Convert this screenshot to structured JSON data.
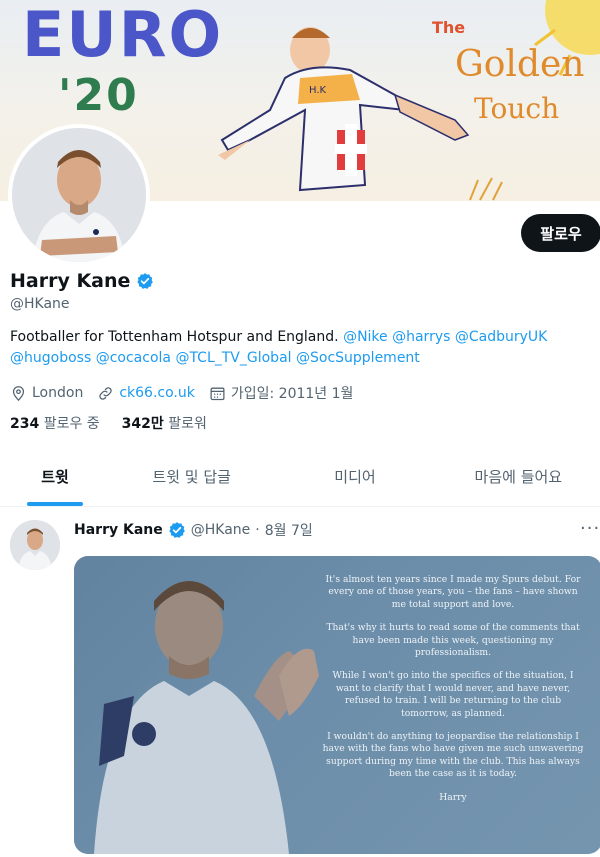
{
  "banner": {
    "title": "EURO",
    "year": "'20",
    "the": "The",
    "golden": "Golden",
    "touch": "Touch",
    "shirt_initials": "H.K"
  },
  "profile": {
    "follow_label": "팔로우",
    "name": "Harry Kane",
    "handle": "@HKane",
    "bio_text": "Footballer for Tottenham Hotspur and England.",
    "bio_mentions": [
      "@Nike",
      "@harrys",
      "@CadburyUK",
      "@hugoboss",
      "@cocacola",
      "@TCL_TV_Global",
      "@SocSupplement"
    ],
    "location": "London",
    "website": "ck66.co.uk",
    "joined": "가입일: 2011년 1월",
    "following_count": "234",
    "following_label": "팔로우 중",
    "followers_count": "342만",
    "followers_label": "팔로워"
  },
  "tabs": [
    {
      "label": "트윗",
      "active": true
    },
    {
      "label": "트윗 및 답글",
      "active": false
    },
    {
      "label": "미디어",
      "active": false
    },
    {
      "label": "마음에 들어요",
      "active": false
    }
  ],
  "tweet": {
    "name": "Harry Kane",
    "handle": "@HKane",
    "separator": "·",
    "date": "8월 7일",
    "more": "···",
    "statement": [
      "It's almost ten years since I made my Spurs debut. For every one of those years, you – the fans – have shown me total support and love.",
      "That's why it hurts to read some of the comments that have been made this week, questioning my professionalism.",
      "While I won't go into the specifics of the situation, I want to clarify that I would never, and have never, refused to train. I will be returning to the club tomorrow, as planned.",
      "I wouldn't do anything to jeopardise the relationship I have with the fans who have given me such unwavering support during my time with the club. This has always been the case as it is today.",
      "Harry"
    ]
  },
  "colors": {
    "accent": "#1d9bf0",
    "text": "#0f1419",
    "muted": "#536471",
    "button": "#0f1419"
  },
  "icons": [
    "verified-badge-icon",
    "location-pin-icon",
    "link-icon",
    "calendar-icon",
    "more-icon"
  ]
}
